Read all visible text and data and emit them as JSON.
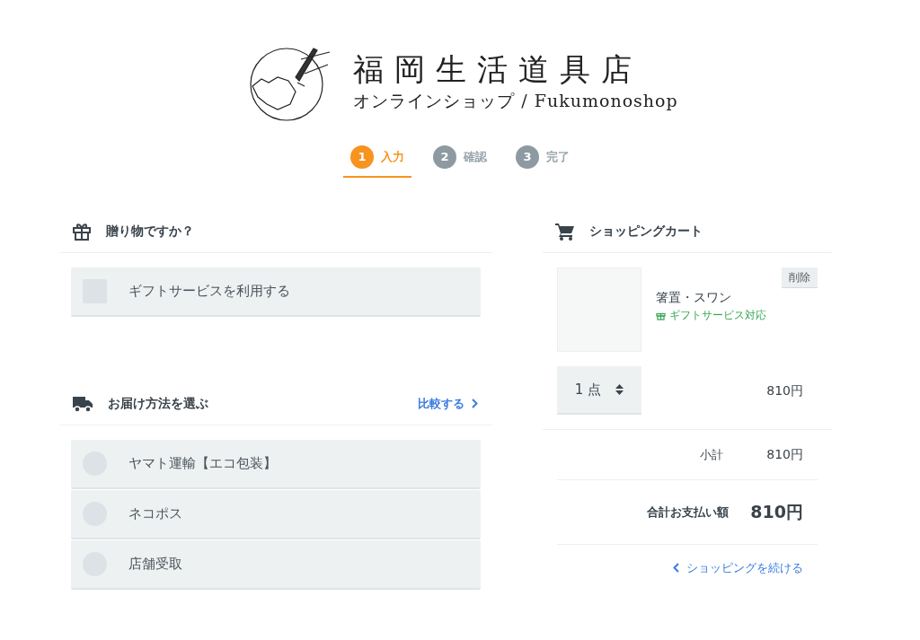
{
  "header": {
    "title": "福岡生活道具店",
    "subtitle": "オンラインショップ / Fukumonoshop"
  },
  "steps": [
    {
      "number": "1",
      "label": "入力",
      "selected": true
    },
    {
      "number": "2",
      "label": "確認",
      "selected": false
    },
    {
      "number": "3",
      "label": "完了",
      "selected": false
    }
  ],
  "gift_section": {
    "title": "贈り物ですか？",
    "option": {
      "label": "ギフトサービスを利用する",
      "checked": false
    }
  },
  "delivery_section": {
    "title": "お届け方法を選ぶ",
    "compare_link": "比較する",
    "options": [
      {
        "label": "ヤマト運輸【エコ包装】",
        "selected": false
      },
      {
        "label": "ネコポス",
        "selected": false
      },
      {
        "label": "店舗受取",
        "selected": false
      }
    ]
  },
  "cart": {
    "title": "ショッピングカート",
    "items": [
      {
        "name": "箸置・スワン",
        "gift_note": "ギフトサービス対応",
        "remove": "削除",
        "quantity": "1 点",
        "price": "810円"
      }
    ],
    "subtotal_label": "小計",
    "subtotal": "810円",
    "total_label": "合計お支払い額",
    "total": "810円",
    "continue_link": "ショッピングを続ける"
  }
}
